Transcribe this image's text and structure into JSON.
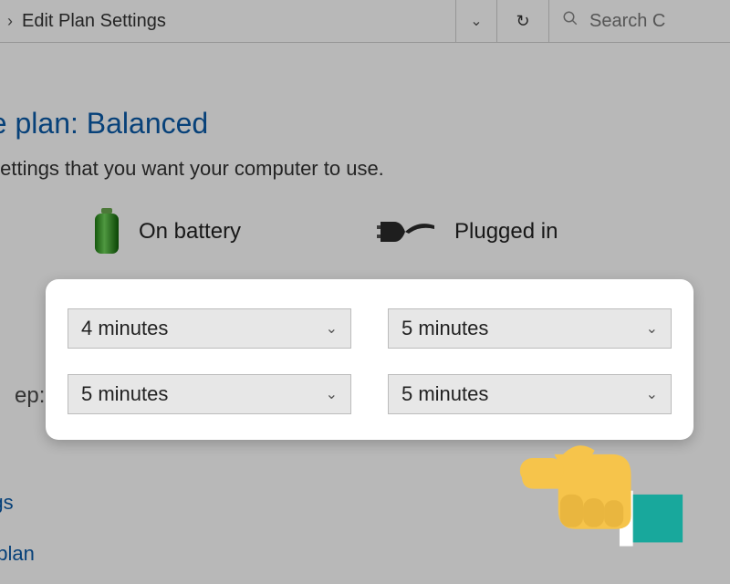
{
  "breadcrumb": {
    "current": "Edit Plan Settings"
  },
  "search": {
    "placeholder": "Search C"
  },
  "page": {
    "title_visible": "he plan: Balanced",
    "description_visible": "y settings that you want your computer to use."
  },
  "modes": {
    "battery_label": "On battery",
    "plugged_label": "Plugged in"
  },
  "rows": {
    "sleep_label_visible": "ep:"
  },
  "dropdowns": {
    "display_battery": "4 minutes",
    "display_plugged": "5 minutes",
    "sleep_battery": "5 minutes",
    "sleep_plugged": "5 minutes"
  },
  "links": {
    "advanced_visible": "ttings",
    "restore_visible": "his plan"
  }
}
